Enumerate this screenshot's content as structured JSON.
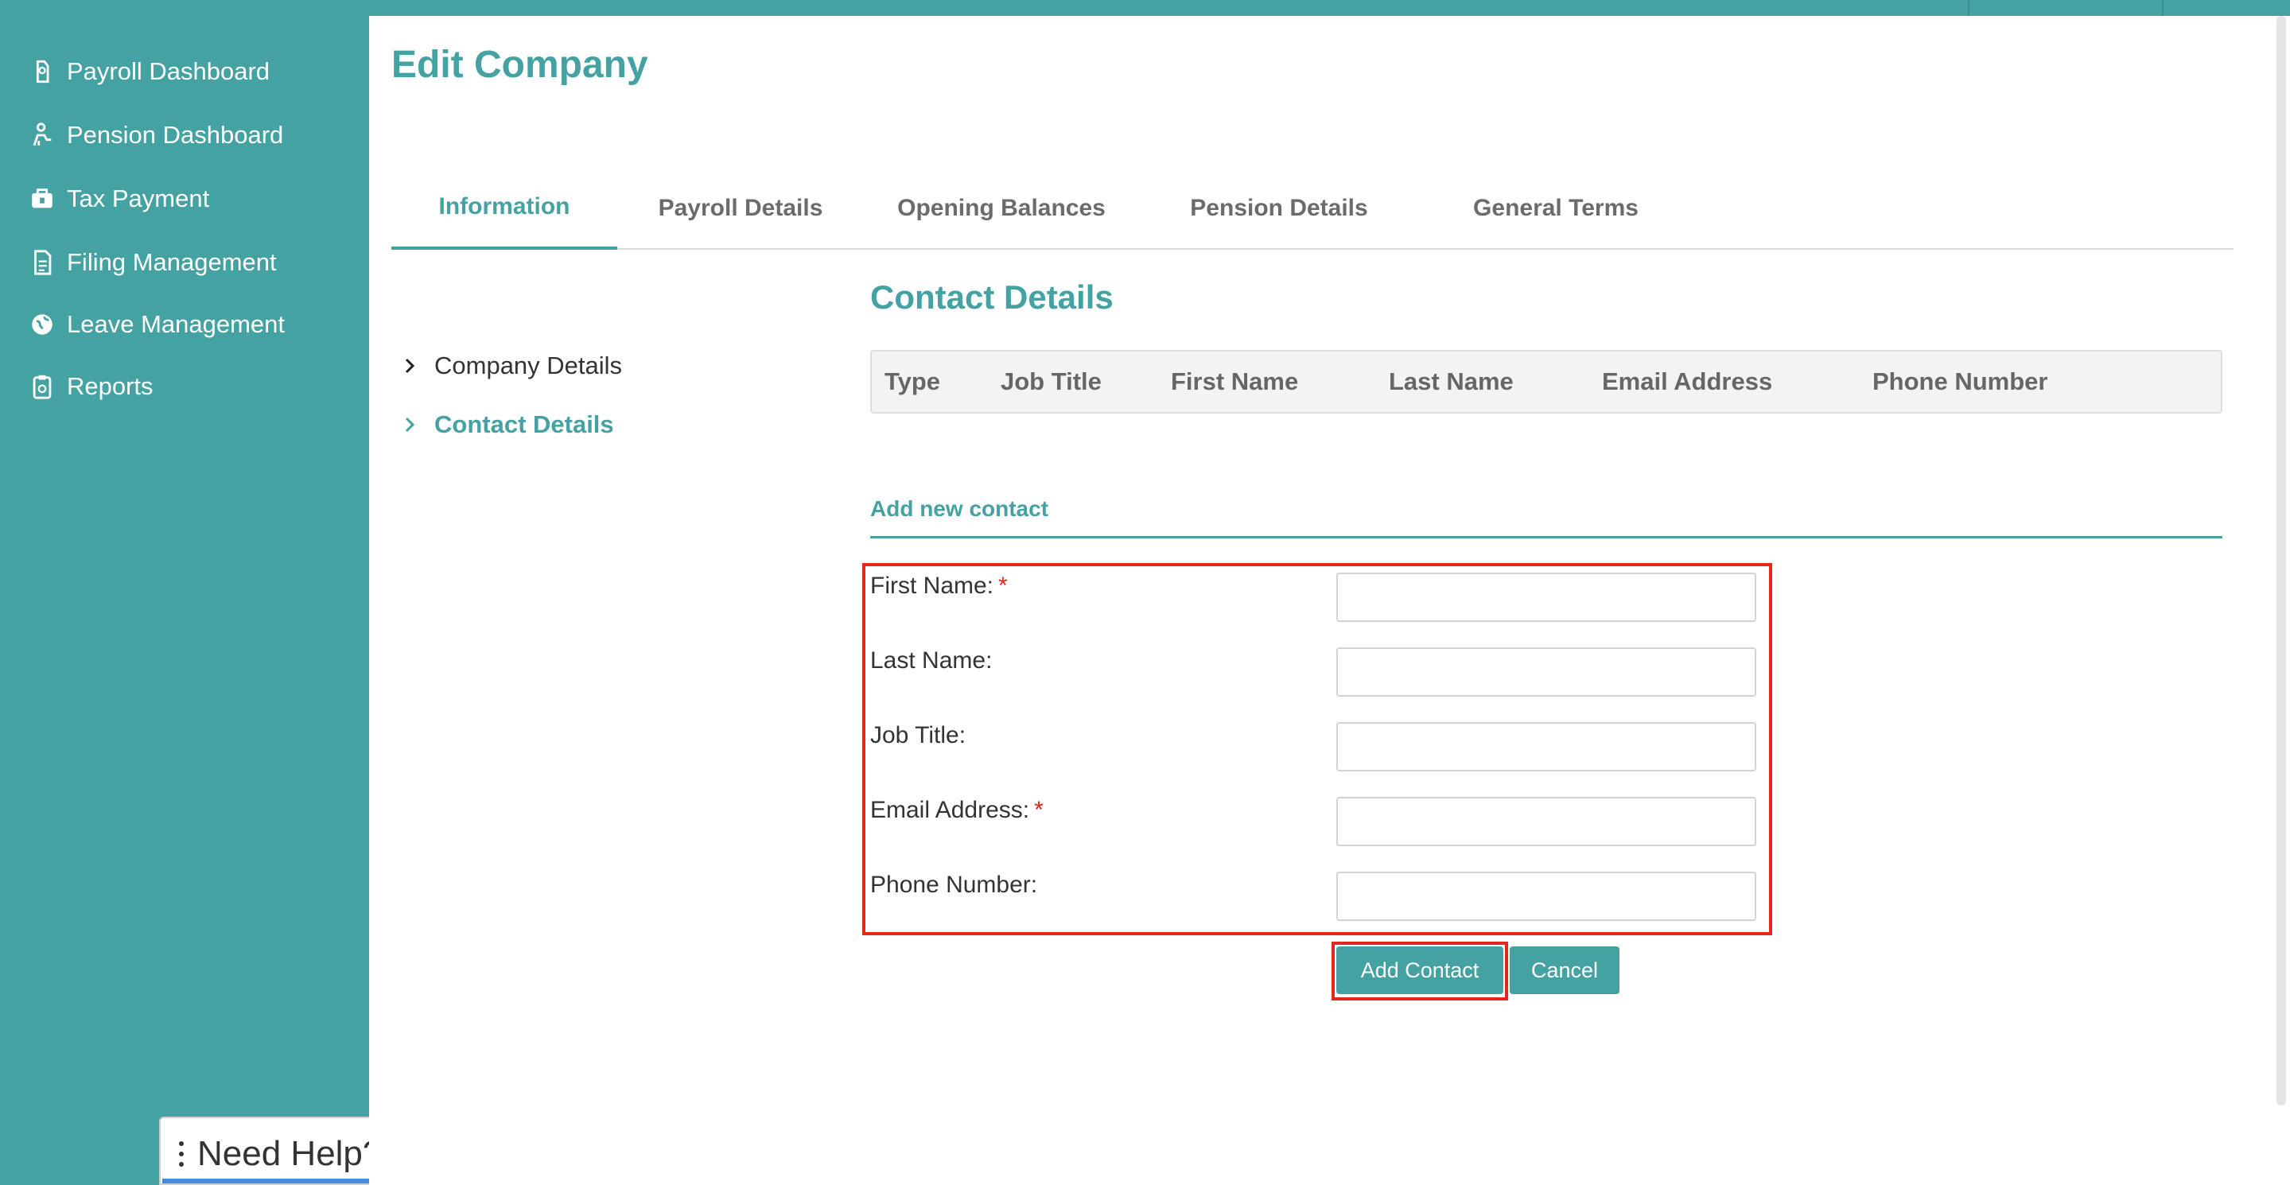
{
  "sidebar": {
    "items": [
      {
        "label": "Payroll Dashboard",
        "icon": "payroll-icon"
      },
      {
        "label": "Pension Dashboard",
        "icon": "pension-icon"
      },
      {
        "label": "Tax Payment",
        "icon": "tax-icon"
      },
      {
        "label": "Filing Management",
        "icon": "filing-icon"
      },
      {
        "label": "Leave Management",
        "icon": "globe-icon"
      },
      {
        "label": "Reports",
        "icon": "reports-icon"
      }
    ]
  },
  "page": {
    "title": "Edit Company"
  },
  "tabs": [
    {
      "label": "Information",
      "active": true
    },
    {
      "label": "Payroll Details"
    },
    {
      "label": "Opening Balances"
    },
    {
      "label": "Pension Details"
    },
    {
      "label": "General Terms"
    }
  ],
  "subnav": [
    {
      "label": "Company Details"
    },
    {
      "label": "Contact Details",
      "active": true
    }
  ],
  "contacts": {
    "title": "Contact Details",
    "columns": [
      "Type",
      "Job Title",
      "First Name",
      "Last Name",
      "Email Address",
      "Phone Number"
    ]
  },
  "form": {
    "title": "Add new contact",
    "fields": [
      {
        "label": "First Name:",
        "required": "*",
        "value": ""
      },
      {
        "label": "Last Name:",
        "value": ""
      },
      {
        "label": "Job Title:",
        "value": ""
      },
      {
        "label": "Email Address:",
        "required": "*",
        "value": ""
      },
      {
        "label": "Phone Number:",
        "value": ""
      }
    ],
    "add_label": "Add Contact",
    "cancel_label": "Cancel"
  },
  "help": {
    "label": "Need Help?"
  },
  "colors": {
    "accent": "#45a2a2",
    "highlight": "#e5261b",
    "help_bar": "#3f8fd6"
  }
}
